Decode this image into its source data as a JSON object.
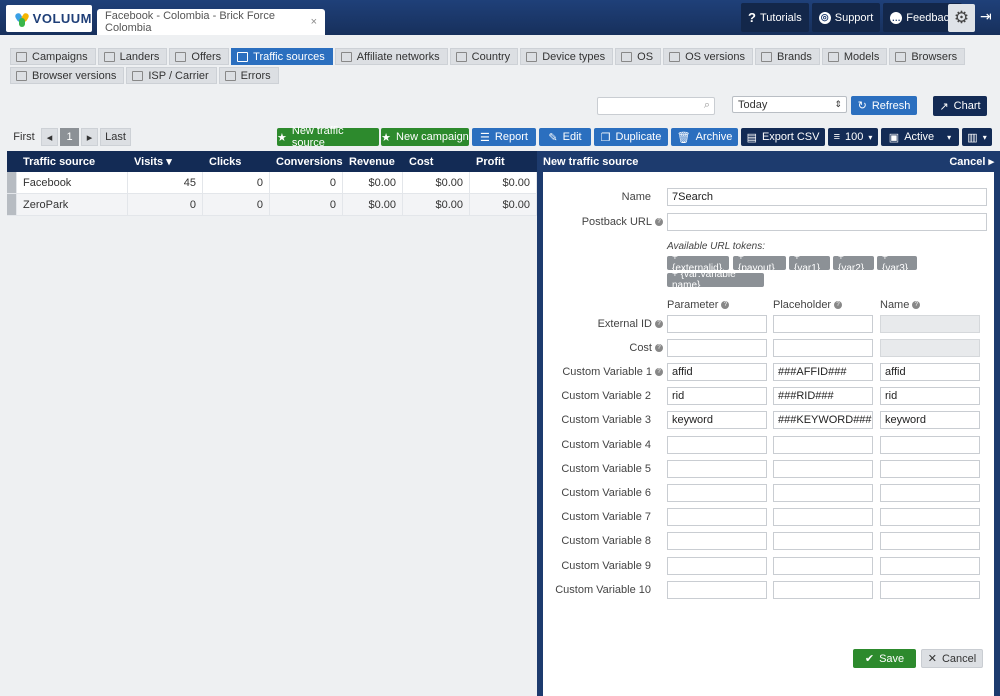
{
  "app": {
    "name": "VOLUUM",
    "tab_title": "Facebook - Colombia - Brick Force Colombia",
    "tab_close": "×"
  },
  "topnav": {
    "tutorials": "Tutorials",
    "support": "Support",
    "feedback": "Feedback"
  },
  "nav_row1": [
    "Campaigns",
    "Landers",
    "Offers",
    "Traffic sources",
    "Affiliate networks",
    "Country",
    "Device types",
    "OS",
    "OS versions",
    "Brands",
    "Models",
    "Browsers"
  ],
  "nav_row2": [
    "Browser versions",
    "ISP / Carrier",
    "Errors"
  ],
  "nav_active": "Traffic sources",
  "toolbar": {
    "date_value": "Today",
    "refresh": "Refresh",
    "chart": "Chart"
  },
  "pager": {
    "first": "First",
    "prev": "◂",
    "page": "1",
    "next": "▸",
    "last": "Last"
  },
  "actions": {
    "new_traffic_source": "New traffic source",
    "new_campaign": "New campaign",
    "report": "Report",
    "edit": "Edit",
    "duplicate": "Duplicate",
    "archive": "Archive",
    "export_csv": "Export CSV",
    "page_size": "100",
    "status": "Active"
  },
  "grid": {
    "columns": [
      "Traffic source",
      "Visits ▾",
      "Clicks",
      "Conversions",
      "Revenue",
      "Cost",
      "Profit"
    ],
    "rows": [
      [
        "Facebook",
        "45",
        "0",
        "0",
        "$0.00",
        "$0.00",
        "$0.00"
      ],
      [
        "ZeroPark",
        "0",
        "0",
        "0",
        "$0.00",
        "$0.00",
        "$0.00"
      ]
    ]
  },
  "panel": {
    "title": "New traffic source",
    "cancel_link": "Cancel ▸",
    "name_label": "Name",
    "name_value": "7Search",
    "postback_label": "Postback URL",
    "postback_value": "",
    "tokens_label": "Available URL tokens:",
    "tokens": [
      "+ {externalid}",
      "+ {payout}",
      "+ {var1}",
      "+ {var2}",
      "+ {var3}",
      "+ {var:variable name}"
    ],
    "col_parameter": "Parameter",
    "col_placeholder": "Placeholder",
    "col_name": "Name",
    "external_id": "External ID",
    "cost": "Cost",
    "variables": [
      {
        "label": "Custom Variable 1",
        "parameter": "affid",
        "placeholder": "###AFFID###",
        "name": "affid"
      },
      {
        "label": "Custom Variable 2",
        "parameter": "rid",
        "placeholder": "###RID###",
        "name": "rid"
      },
      {
        "label": "Custom Variable 3",
        "parameter": "keyword",
        "placeholder": "###KEYWORD###",
        "name": "keyword"
      },
      {
        "label": "Custom Variable 4",
        "parameter": "",
        "placeholder": "",
        "name": ""
      },
      {
        "label": "Custom Variable 5",
        "parameter": "",
        "placeholder": "",
        "name": ""
      },
      {
        "label": "Custom Variable 6",
        "parameter": "",
        "placeholder": "",
        "name": ""
      },
      {
        "label": "Custom Variable 7",
        "parameter": "",
        "placeholder": "",
        "name": ""
      },
      {
        "label": "Custom Variable 8",
        "parameter": "",
        "placeholder": "",
        "name": ""
      },
      {
        "label": "Custom Variable 9",
        "parameter": "",
        "placeholder": "",
        "name": ""
      },
      {
        "label": "Custom Variable 10",
        "parameter": "",
        "placeholder": "",
        "name": ""
      }
    ],
    "save": "Save",
    "cancel": "Cancel"
  }
}
